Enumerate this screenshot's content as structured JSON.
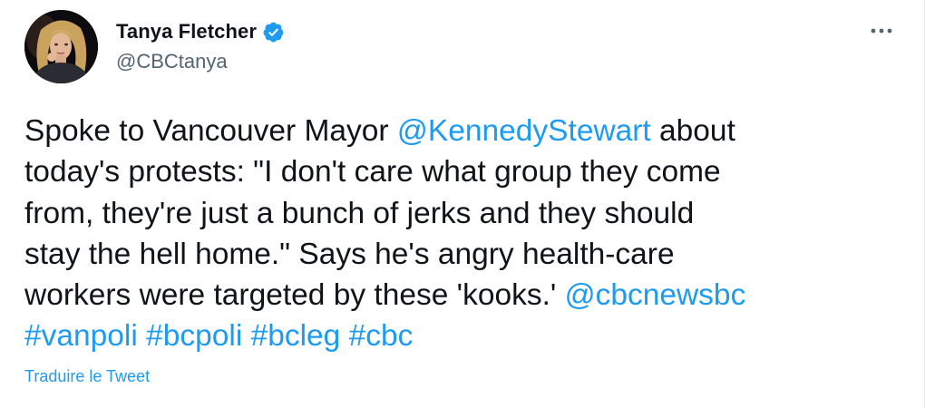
{
  "author": {
    "display_name": "Tanya Fletcher",
    "handle": "@CBCtanya",
    "verified_icon": "verified-badge-icon",
    "avatar_icon": "profile-photo"
  },
  "menu": {
    "more_icon": "more-horizontal-icon"
  },
  "tweet": {
    "line1": {
      "t1": "Spoke to Vancouver Mayor ",
      "mention1": "@KennedyStewart",
      "t2": " about"
    },
    "line2": {
      "t1": "today's protests: \"I don't care what group they come"
    },
    "line3": {
      "t1": "from, they're just a bunch of jerks and they should"
    },
    "line4": {
      "t1": "stay the hell home.\" Says he's angry health-care"
    },
    "line5": {
      "t1": "workers were targeted by these 'kooks.' ",
      "mention2": "@cbcnewsbc"
    },
    "line6": {
      "tag1": "#vanpoli",
      "sp1": " ",
      "tag2": "#bcpoli",
      "sp2": " ",
      "tag3": "#bcleg",
      "sp3": " ",
      "tag4": "#cbc"
    }
  },
  "translate_label": "Traduire le Tweet",
  "colors": {
    "link": "#1d9bf0",
    "text": "#0f1419",
    "secondary": "#536471"
  }
}
